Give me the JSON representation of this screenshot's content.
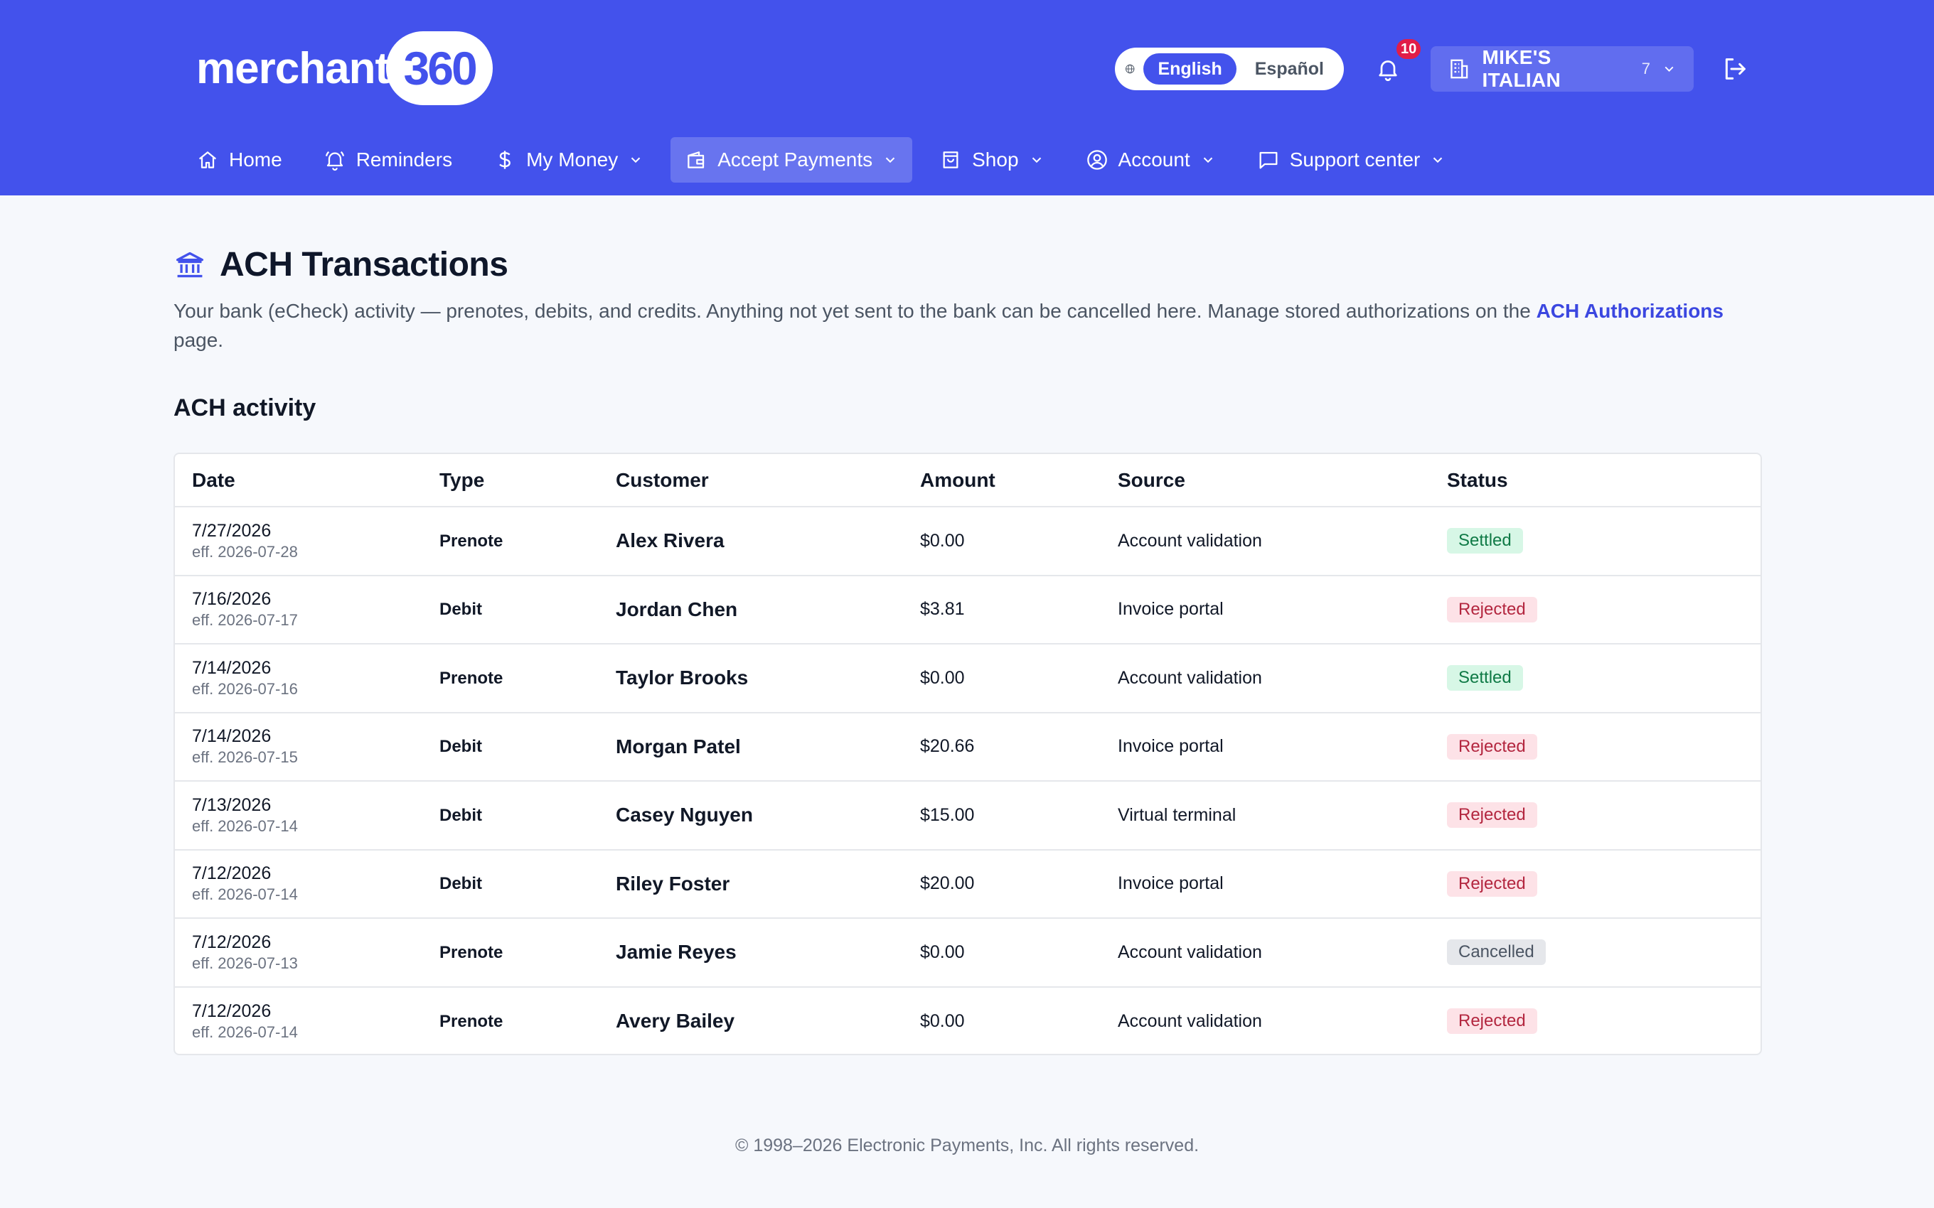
{
  "brand": {
    "word": "merchant",
    "number": "360"
  },
  "language": {
    "active": "English",
    "other": "Español"
  },
  "notifications": {
    "count": "10"
  },
  "merchant": {
    "name": "MIKE'S ITALIAN",
    "count": "7"
  },
  "nav": [
    {
      "label": "Home",
      "icon": "home-icon"
    },
    {
      "label": "Reminders",
      "icon": "bell-icon"
    },
    {
      "label": "My Money",
      "icon": "dollar-icon"
    },
    {
      "label": "Accept Payments",
      "icon": "wallet-icon"
    },
    {
      "label": "Shop",
      "icon": "shopping-bag-icon"
    },
    {
      "label": "Account",
      "icon": "user-circle-icon"
    },
    {
      "label": "Support center",
      "icon": "chat-icon"
    }
  ],
  "page": {
    "title": "ACH Transactions",
    "description_pre": "Your bank (eCheck) activity — prenotes, debits, and credits. Anything not yet sent to the bank can be cancelled here. Manage stored authorizations on the ",
    "description_link": "ACH Authorizations",
    "description_post": " page.",
    "section_title": "ACH activity"
  },
  "table": {
    "headers": {
      "date": "Date",
      "type": "Type",
      "customer": "Customer",
      "amount": "Amount",
      "source": "Source",
      "status": "Status"
    },
    "rows": [
      {
        "date": "7/27/2026",
        "eff": "eff. 2026-07-28",
        "type": "Prenote",
        "customer": "Alex Rivera",
        "amount": "$0.00",
        "source": "Account validation",
        "status": "Settled"
      },
      {
        "date": "7/16/2026",
        "eff": "eff. 2026-07-17",
        "type": "Debit",
        "customer": "Jordan Chen",
        "amount": "$3.81",
        "source": "Invoice portal",
        "status": "Rejected"
      },
      {
        "date": "7/14/2026",
        "eff": "eff. 2026-07-16",
        "type": "Prenote",
        "customer": "Taylor Brooks",
        "amount": "$0.00",
        "source": "Account validation",
        "status": "Settled"
      },
      {
        "date": "7/14/2026",
        "eff": "eff. 2026-07-15",
        "type": "Debit",
        "customer": "Morgan Patel",
        "amount": "$20.66",
        "source": "Invoice portal",
        "status": "Rejected"
      },
      {
        "date": "7/13/2026",
        "eff": "eff. 2026-07-14",
        "type": "Debit",
        "customer": "Casey Nguyen",
        "amount": "$15.00",
        "source": "Virtual terminal",
        "status": "Rejected"
      },
      {
        "date": "7/12/2026",
        "eff": "eff. 2026-07-14",
        "type": "Debit",
        "customer": "Riley Foster",
        "amount": "$20.00",
        "source": "Invoice portal",
        "status": "Rejected"
      },
      {
        "date": "7/12/2026",
        "eff": "eff. 2026-07-13",
        "type": "Prenote",
        "customer": "Jamie Reyes",
        "amount": "$0.00",
        "source": "Account validation",
        "status": "Cancelled"
      },
      {
        "date": "7/12/2026",
        "eff": "eff. 2026-07-14",
        "type": "Prenote",
        "customer": "Avery Bailey",
        "amount": "$0.00",
        "source": "Account validation",
        "status": "Rejected"
      }
    ]
  },
  "footer": {
    "text": "© 1998–2026 Electronic Payments, Inc. All rights reserved."
  },
  "colors": {
    "primary": "#4352ec",
    "link": "#3b47e0",
    "settled": "#0f7a46",
    "rejected": "#b3263f",
    "cancelled": "#4b5563"
  }
}
